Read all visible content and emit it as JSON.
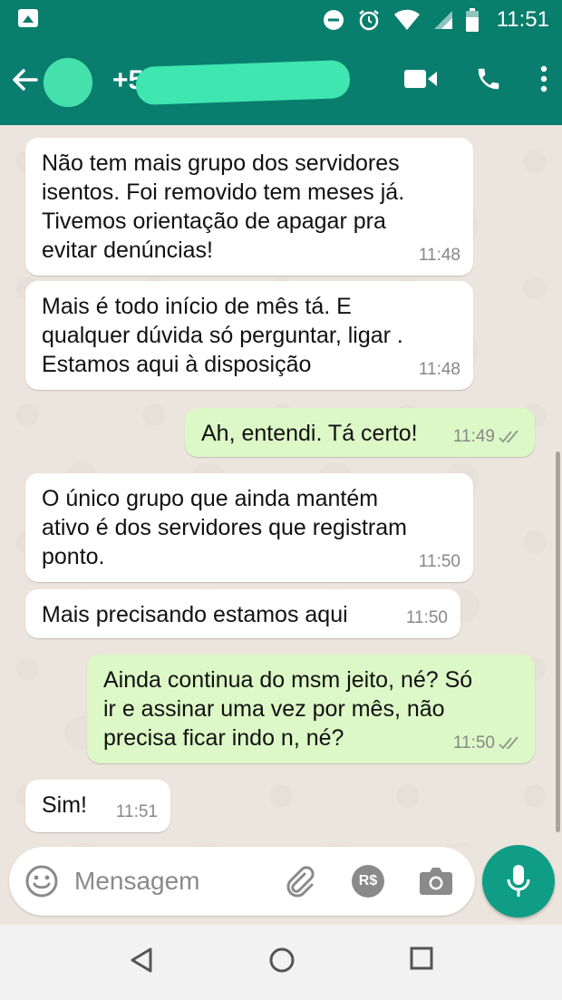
{
  "status_bar": {
    "time": "11:51"
  },
  "header": {
    "contact_visible": "+55"
  },
  "messages": [
    {
      "direction": "in",
      "text": "Não tem mais grupo dos servidores\nisentos. Foi removido tem meses já.\nTivemos orientação de apagar pra\nevitar denúncias!",
      "time": "11:48"
    },
    {
      "direction": "in",
      "text": "Mais é todo início de mês tá. E\nqualquer dúvida só perguntar, ligar .\nEstamos aqui à disposição",
      "time": "11:48"
    },
    {
      "direction": "out",
      "text": "Ah, entendi. Tá certo!",
      "time": "11:49",
      "status": "read"
    },
    {
      "direction": "in",
      "text": "O único grupo que ainda mantém\nativo é dos servidores que registram\nponto.",
      "time": "11:50"
    },
    {
      "direction": "in",
      "text": "Mais precisando estamos aqui",
      "time": "11:50"
    },
    {
      "direction": "out",
      "text": "Ainda continua do msm jeito, né? Só\nir e assinar uma vez por mês, não\nprecisa ficar indo n, né?",
      "time": "11:50",
      "status": "read"
    },
    {
      "direction": "in",
      "text": "Sim!",
      "time": "11:51"
    }
  ],
  "composer": {
    "placeholder": "Mensagem",
    "pay_label": "R$"
  },
  "colors": {
    "header": "#0a7e6e",
    "outgoing_bubble": "#dcf8c6",
    "incoming_bubble": "#ffffff",
    "mic_button": "#0f9d86"
  }
}
